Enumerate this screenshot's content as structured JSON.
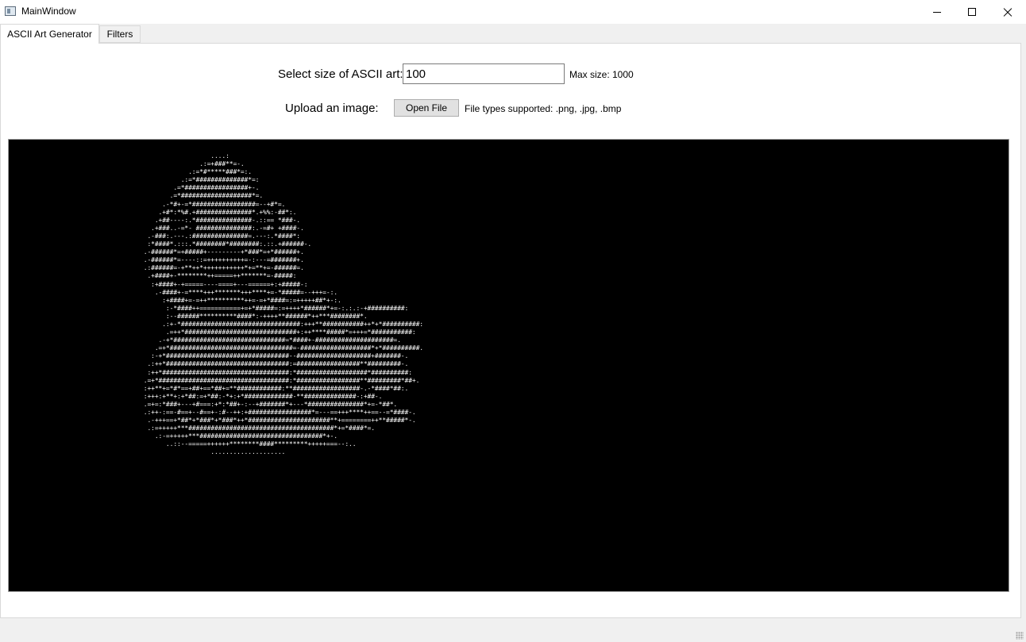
{
  "window": {
    "title": "MainWindow"
  },
  "tabs": [
    {
      "label": "ASCII Art Generator",
      "selected": true
    },
    {
      "label": "Filters",
      "selected": false
    }
  ],
  "form": {
    "size_label": "Select size of ASCII art:",
    "size_value": "100",
    "max_size_label": "Max size: 1000",
    "upload_label": "Upload an image:",
    "open_button": "Open File",
    "file_types_label": "File types supported: .png, .jpg, .bmp"
  },
  "ascii_art": {
    "background": "#000000",
    "foreground": "#ffffff",
    "text": "                                ....:\n                             .:=+###**=-.\n                          .:=*#*****###*=:.\n                        .:=*##############*=:\n                      .=*#################+-.\n                     .=*###################*=.\n                   .-*#+-=*#################=--+#*=.\n                  .+#*:*%#.+###############*.+%%:-##*:.\n                 .+##----:.*###############-.::== *###-.\n                .+###..-=*- ###############:.-=#+ +####-.\n               .-###:.---.:###############=.---:.*####*:\n               :*####*.:::.*########*########:.::.+######-.\n              .-######*=+#####+---------+*###*=+*######+.\n              .-######*=----::=++++++++++=-:---=#######+.\n              .:######=-+**++*+++++++++++*+=**+=-######=.\n               .+####+-********++=====++*******=-#####:\n                :+####+-+=====----====+---======+:+#####-:\n                 .-####+-=****+++*******+++****+=-*#####=--+++=-:.\n                   :+####+=-=++**********++=-=+*####=:=+++++##*+-:.\n                    :-*####++===========+=+*#####=:=++++*######*+=-:.:.:-+##########:\n                    :--######**********####*:-++++**######*++***########*.\n                   .:+-*################################:+++**###########++*+*##########:\n                    .=++*##############################+:++****#####*=+++=*###########:\n                  .-+*##############################=*####+-#####################=.\n                 .=+*#################################=-###################*+*##########.\n                :-+*#################################--####################+#######-.\n               .:++*#################################:=#################**#########-.\n               :++*##################################:*###################*##########:\n              .=+*###################################:*#################**#########*##+.\n              :++**+=*#*==+##+==*##+=**############:**##################-.-*####*##:.\n              :+++:+**+:+*##:=+*##:-*+:+*#############-**##############-:+##-.\n              .=+=:*###+---+#===:+*:*##+-:--+#######*+---*###############*+=-*##*.\n              .:++-:==-#==+--#==+-:#--++:+#################*=---==+++****++==--=*####-.\n               .-+++==+*##*+*###*+*###*++*######################**+========++**#####*-.\n               .:=+++++***#######################################*+=*####*=.\n                 .:-=+++++***#################################*+-.\n                    ..::--=====++++++********####*********+++++===--:..\n                                ....................\n"
  }
}
